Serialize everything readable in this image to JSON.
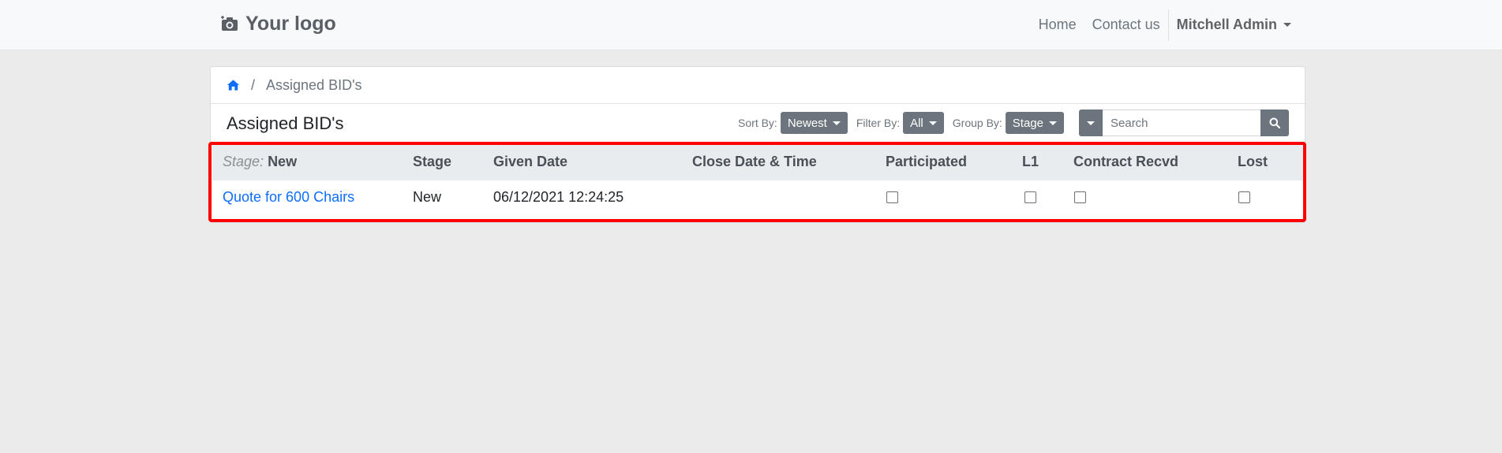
{
  "header": {
    "logo_text": "Your logo",
    "nav": {
      "home": "Home",
      "contact": "Contact us",
      "user": "Mitchell Admin"
    }
  },
  "breadcrumb": {
    "current": "Assigned BID's"
  },
  "toolbar": {
    "title": "Assigned BID's",
    "sort_label": "Sort By:",
    "sort_value": "Newest",
    "filter_label": "Filter By:",
    "filter_value": "All",
    "group_label": "Group By:",
    "group_value": "Stage",
    "search_placeholder": "Search"
  },
  "table": {
    "group_prefix": "Stage:",
    "group_name": "New",
    "columns": {
      "stage": "Stage",
      "given_date": "Given Date",
      "close_date": "Close Date & Time",
      "participated": "Participated",
      "l1": "L1",
      "contract": "Contract Recvd",
      "lost": "Lost"
    },
    "rows": [
      {
        "name": "Quote for 600 Chairs",
        "stage": "New",
        "given_date": "06/12/2021 12:24:25",
        "close_date": "",
        "participated": false,
        "l1": false,
        "contract": false,
        "lost": false
      }
    ]
  },
  "colors": {
    "highlight": "#ff0000",
    "link": "#0d6efd",
    "button": "#6c757d"
  }
}
